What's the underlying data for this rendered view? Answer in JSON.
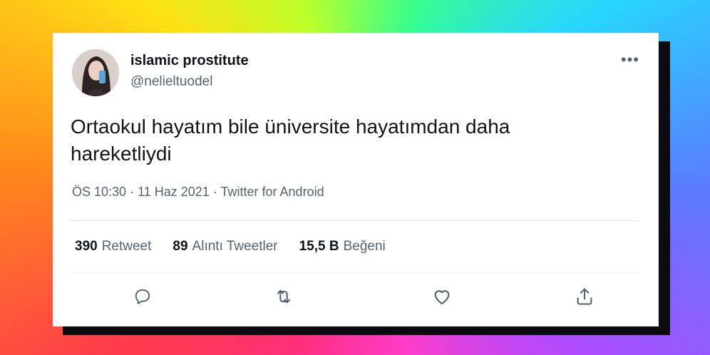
{
  "tweet": {
    "display_name": "islamic prostitute",
    "handle": "@nelieltuodel",
    "text": "Ortaokul hayatım bile üniversite hayatımdan daha hareketliydi",
    "time": "ÖS 10:30",
    "date": "11 Haz 2021",
    "source": "Twitter for Android",
    "more_icon": "more-dots-icon"
  },
  "stats": {
    "retweets_count": "390",
    "retweets_label": "Retweet",
    "quotes_count": "89",
    "quotes_label": "Alıntı Tweetler",
    "likes_count": "15,5 B",
    "likes_label": "Beğeni"
  },
  "actions": [
    "reply-icon",
    "retweet-icon",
    "like-icon",
    "share-icon"
  ],
  "colors": {
    "text": "#0f1419",
    "secondary": "#536471",
    "divider": "#e7ebee"
  }
}
